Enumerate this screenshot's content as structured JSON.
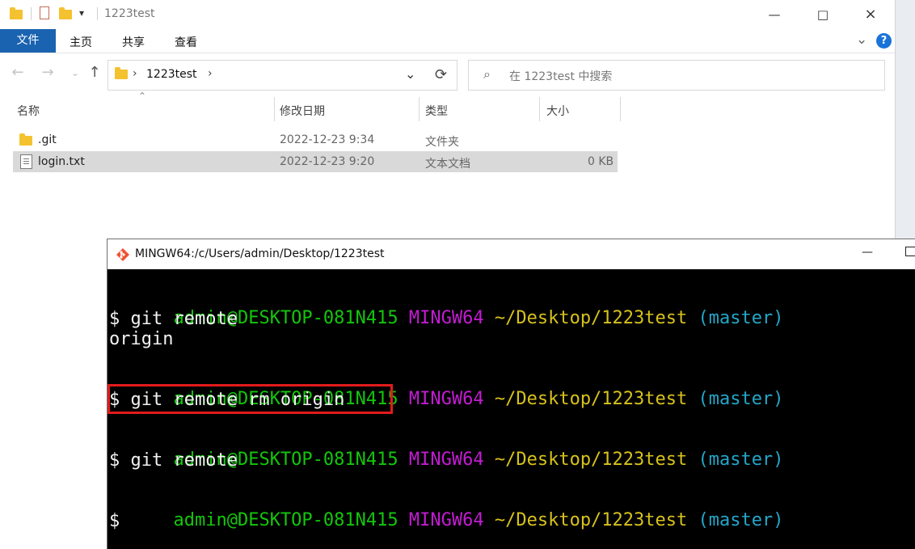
{
  "explorer": {
    "title": "1223test",
    "ribbon": {
      "tabs": [
        "文件",
        "主页",
        "共享",
        "查看"
      ]
    },
    "breadcrumb": [
      "1223test"
    ],
    "search_placeholder": "在 1223test 中搜索",
    "columns": [
      "名称",
      "修改日期",
      "类型",
      "大小"
    ],
    "rows": [
      {
        "name": ".git",
        "date": "2022-12-23 9:34",
        "type": "文件夹",
        "size": ""
      },
      {
        "name": "login.txt",
        "date": "2022-12-23 9:20",
        "type": "文本文档",
        "size": "0 KB"
      }
    ],
    "icons": {
      "title_folder": "folder-icon",
      "title_check": "checklist-icon",
      "title_folder_2": "folder-icon",
      "title_dropdown": "chevron-down-icon",
      "minimize": "minimize-icon",
      "maximize": "maximize-icon",
      "close": "close-icon",
      "ribbon_chevron": "chevron-down-icon",
      "help": "help-icon",
      "back": "back-arrow-icon",
      "forward": "forward-arrow-icon",
      "recent": "chevron-down-icon",
      "up": "up-arrow-icon",
      "address_folder": "folder-icon",
      "address_chevron": "chevron-right-icon",
      "address_dropdown": "chevron-down-icon",
      "refresh": "refresh-icon",
      "search": "search-icon",
      "sort": "sort-up-icon",
      "git_folder": "folder-icon",
      "login_doc": "document-icon"
    },
    "colors": {
      "accent": "#1a63b0",
      "selection": "#d9d9d9"
    }
  },
  "terminal": {
    "title": "MINGW64:/c/Users/admin/Desktop/1223test",
    "lines": [
      {
        "segments": [
          {
            "text": "admin@DESKTOP-081N415",
            "color": "green"
          },
          {
            "text": " MINGW64",
            "color": "magenta"
          },
          {
            "text": " ~/Desktop/1223test",
            "color": "yellow"
          },
          {
            "text": " (master)",
            "color": "cyan"
          }
        ]
      },
      {
        "segments": [
          {
            "text": "$ git remote",
            "color": "white"
          }
        ]
      },
      {
        "segments": [
          {
            "text": "origin",
            "color": "white"
          }
        ]
      },
      {
        "segments": [
          {
            "text": "admin@DESKTOP-081N415",
            "color": "green"
          },
          {
            "text": " MINGW64",
            "color": "magenta"
          },
          {
            "text": " ~/Desktop/1223test",
            "color": "yellow"
          },
          {
            "text": " (master)",
            "color": "cyan"
          }
        ]
      },
      {
        "segments": [
          {
            "text": "$ git remote rm origin",
            "color": "white"
          }
        ]
      },
      {
        "segments": [
          {
            "text": "admin@DESKTOP-081N415",
            "color": "green"
          },
          {
            "text": " MINGW64",
            "color": "magenta"
          },
          {
            "text": " ~/Desktop/1223test",
            "color": "yellow"
          },
          {
            "text": " (master)",
            "color": "cyan"
          }
        ]
      },
      {
        "segments": [
          {
            "text": "$ git remote",
            "color": "white"
          }
        ]
      },
      {
        "segments": [
          {
            "text": "admin@DESKTOP-081N415",
            "color": "green"
          },
          {
            "text": " MINGW64",
            "color": "magenta"
          },
          {
            "text": " ~/Desktop/1223test",
            "color": "yellow"
          },
          {
            "text": " (master)",
            "color": "cyan"
          }
        ]
      },
      {
        "segments": [
          {
            "text": "$",
            "color": "white"
          }
        ]
      }
    ],
    "icons": {
      "app": "git-icon",
      "minimize": "minimize-icon",
      "maximize": "maximize-icon",
      "close": "close-icon"
    },
    "colors": {
      "green": "#13c70b",
      "magenta": "#c41bd3",
      "yellow": "#d7c21b",
      "cyan": "#23a7c8",
      "white": "#efefef",
      "highlight": "#e21b1b"
    }
  }
}
